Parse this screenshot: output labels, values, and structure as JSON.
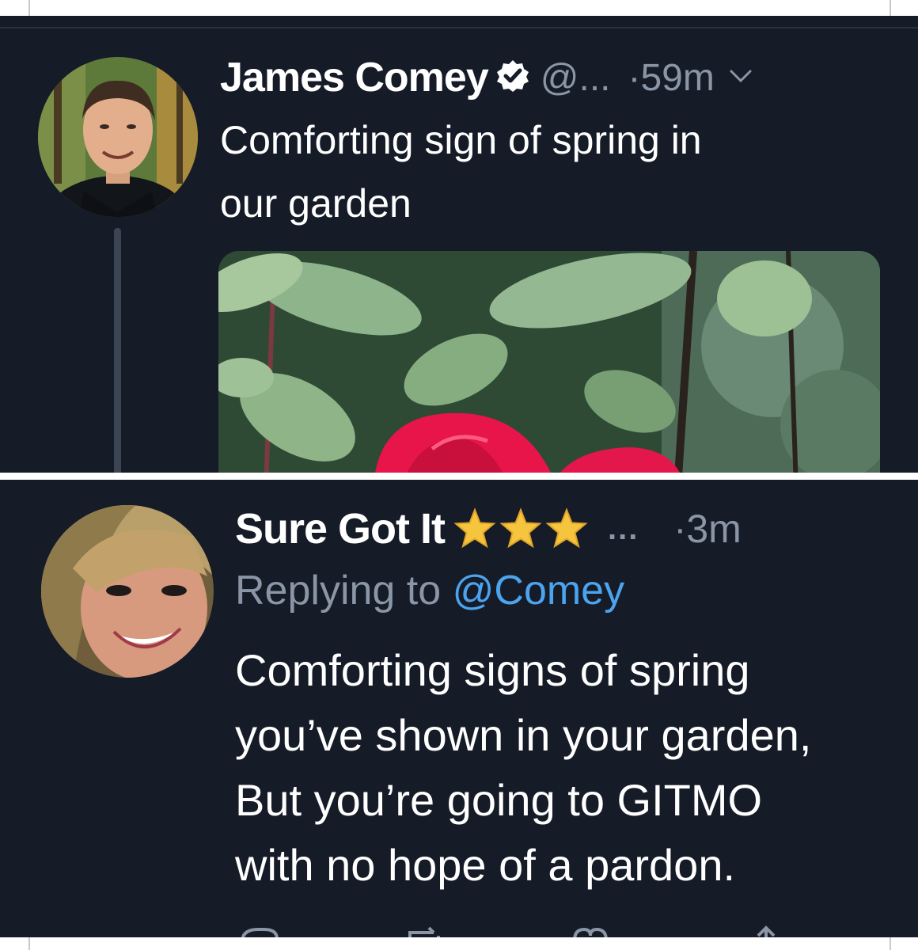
{
  "tweet": {
    "author_name": "James Comey",
    "handle": "@...",
    "separator": "·",
    "time": "59m",
    "text_lines": [
      "Comforting sign of spring in",
      "our garden"
    ],
    "icons": {
      "verified": "verified-badge-icon",
      "more": "chevron-down-icon"
    },
    "image_subject": "red rose among green leaves"
  },
  "reply": {
    "author_name": "Sure Got It",
    "star_count": 3,
    "more_label": "...",
    "separator": "·",
    "time": "3m",
    "replying_to_label": "Replying to",
    "replying_to_handle": "@Comey",
    "text_lines": [
      "Comforting signs of spring",
      "you’ve shown in your garden,",
      "But you’re going to GITMO",
      "with no hope of a pardon."
    ],
    "action_icons": [
      "reply-icon",
      "retweet-icon",
      "like-icon",
      "share-icon"
    ]
  },
  "colors": {
    "background": "#151b27",
    "primary_text": "#ffffff",
    "secondary_text": "#8a96a6",
    "link": "#4ca3ee",
    "star": "#f5c53d",
    "rose": "#e8154a"
  }
}
